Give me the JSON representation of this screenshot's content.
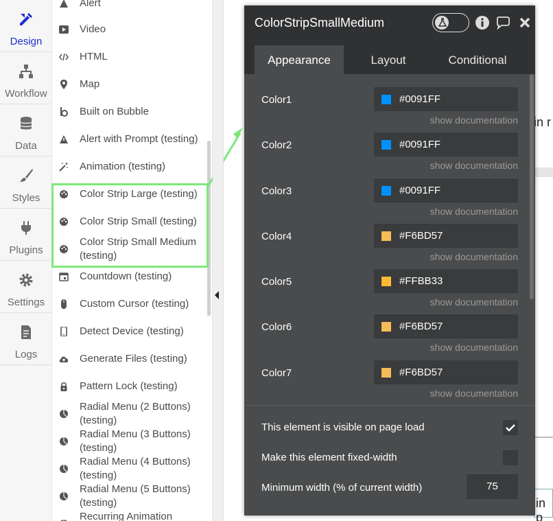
{
  "leftnav": {
    "items": [
      {
        "label": "Design",
        "icon": "design-icon"
      },
      {
        "label": "Workflow",
        "icon": "workflow-icon"
      },
      {
        "label": "Data",
        "icon": "data-icon"
      },
      {
        "label": "Styles",
        "icon": "brush-icon"
      },
      {
        "label": "Plugins",
        "icon": "plug-icon"
      },
      {
        "label": "Settings",
        "icon": "gear-icon"
      },
      {
        "label": "Logs",
        "icon": "document-icon"
      }
    ],
    "active_color": "#1f2fd1"
  },
  "palette": {
    "items": [
      {
        "label": "Alert",
        "icon": "alert-icon"
      },
      {
        "label": "Video",
        "icon": "video-icon"
      },
      {
        "label": "HTML",
        "icon": "code-icon"
      },
      {
        "label": "Map",
        "icon": "map-pin-icon"
      },
      {
        "label": "Built on Bubble",
        "icon": "bubble-icon"
      },
      {
        "label": "Alert with Prompt (testing)",
        "icon": "warning-icon"
      },
      {
        "label": "Animation (testing)",
        "icon": "wand-icon"
      },
      {
        "label": "Color Strip Large (testing)",
        "icon": "palette-icon"
      },
      {
        "label": "Color Strip Small (testing)",
        "icon": "palette-icon"
      },
      {
        "label": "Color Strip Small Medium (testing)",
        "icon": "palette-icon"
      },
      {
        "label": "Countdown (testing)",
        "icon": "calendar-icon"
      },
      {
        "label": "Custom Cursor (testing)",
        "icon": "mouse-icon"
      },
      {
        "label": "Detect Device (testing)",
        "icon": "mobile-icon"
      },
      {
        "label": "Generate Files (testing)",
        "icon": "cloud-upload-icon"
      },
      {
        "label": "Pattern Lock (testing)",
        "icon": "lock-icon"
      },
      {
        "label": "Radial Menu (2 Buttons) (testing)",
        "icon": "pie-icon"
      },
      {
        "label": "Radial Menu (3 Buttons) (testing)",
        "icon": "pie-icon"
      },
      {
        "label": "Radial Menu (4 Buttons) (testing)",
        "icon": "pie-icon"
      },
      {
        "label": "Radial Menu (5 Buttons) (testing)",
        "icon": "pie-icon"
      },
      {
        "label": "Recurring Animation",
        "icon": "pie-icon"
      }
    ],
    "highlight_color": "#7de87a"
  },
  "canvas": {
    "fragment_top": "in r",
    "fragment_bottom": "in p"
  },
  "panel": {
    "title": "ColorStripSmallMedium",
    "tabs": [
      "Appearance",
      "Layout",
      "Conditional"
    ],
    "active_tab": "Appearance",
    "doc_link": "show documentation",
    "colors": [
      {
        "label": "Color1",
        "value": "#0091FF"
      },
      {
        "label": "Color2",
        "value": "#0091FF"
      },
      {
        "label": "Color3",
        "value": "#0091FF"
      },
      {
        "label": "Color4",
        "value": "#F6BD57"
      },
      {
        "label": "Color5",
        "value": "#FFBB33"
      },
      {
        "label": "Color6",
        "value": "#F6BD57"
      },
      {
        "label": "Color7",
        "value": "#F6BD57"
      }
    ],
    "options": {
      "visible_label": "This element is visible on page load",
      "visible_checked": true,
      "fixed_width_label": "Make this element fixed-width",
      "fixed_width_checked": false,
      "min_width_label": "Minimum width (% of current width)",
      "min_width_value": "75"
    }
  }
}
